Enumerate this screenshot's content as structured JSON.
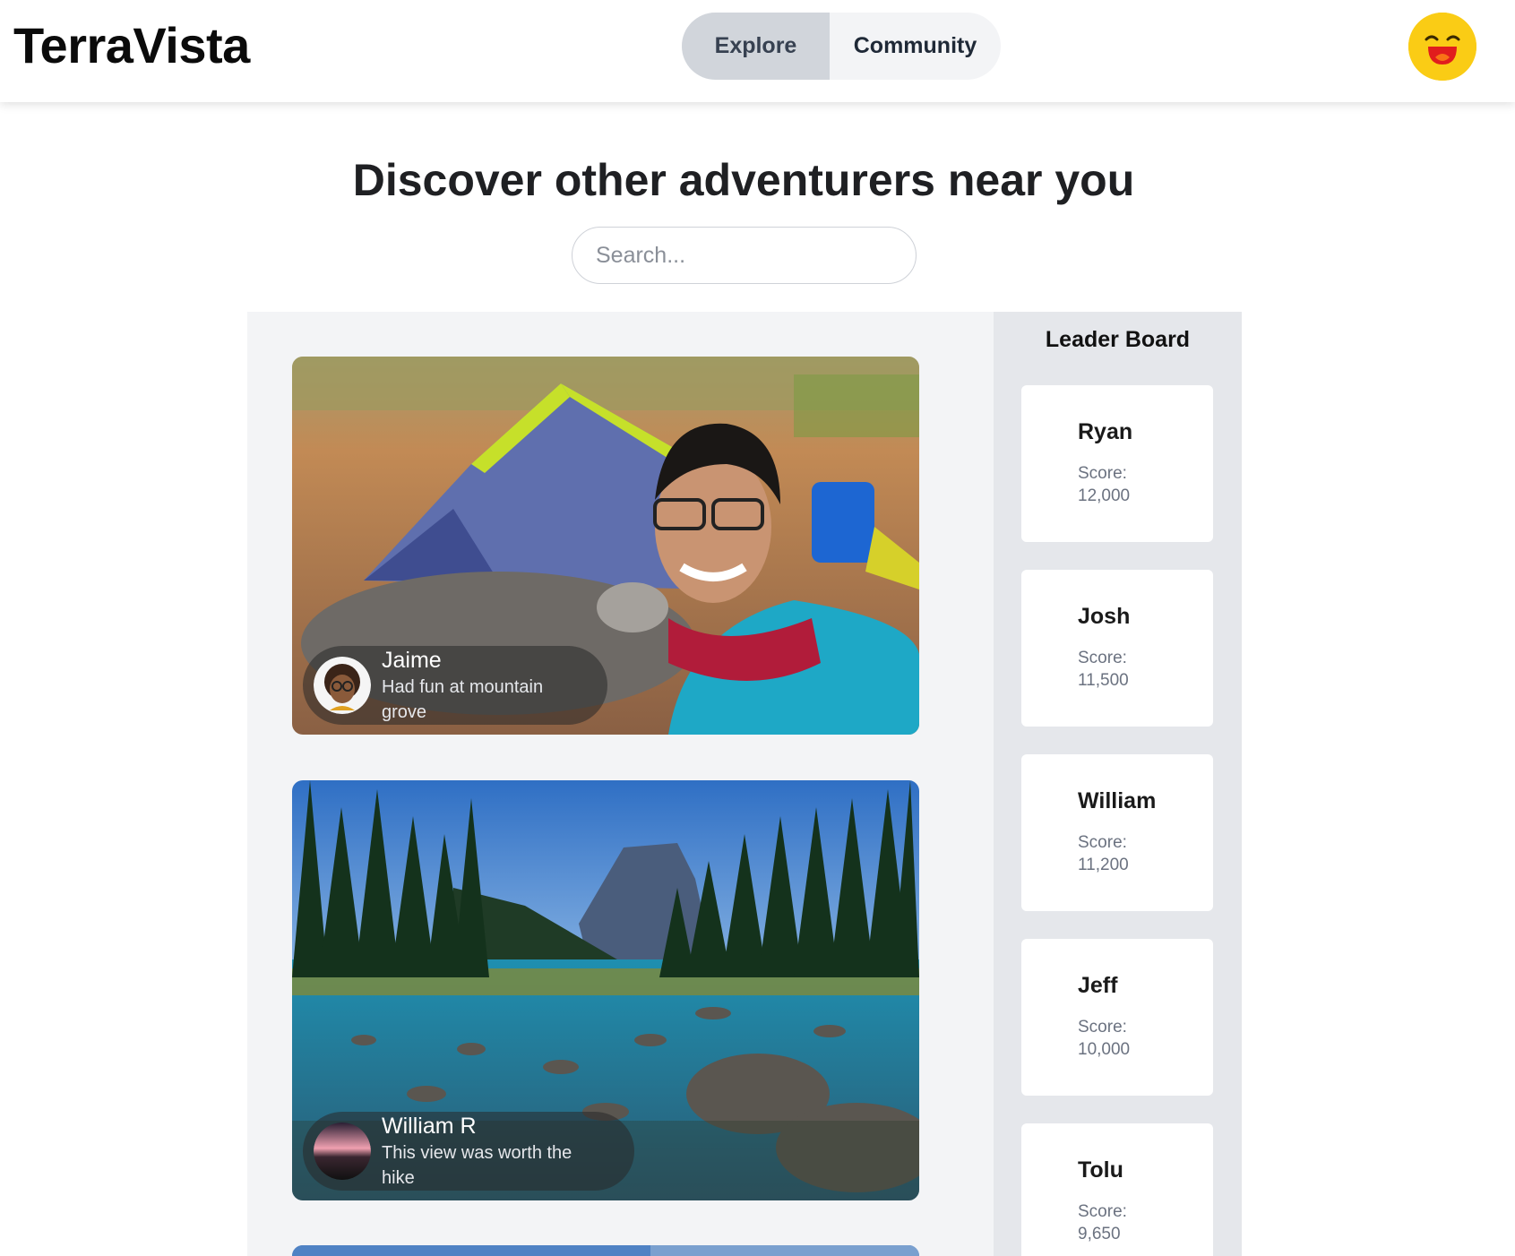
{
  "app": {
    "title": "TerraVista"
  },
  "nav": {
    "tabs": [
      {
        "label": "Explore",
        "active": true
      },
      {
        "label": "Community",
        "active": false
      }
    ]
  },
  "user": {
    "avatar_icon": "laughing-face-icon",
    "avatar_color": "#facc15"
  },
  "main": {
    "title": "Discover other adventurers near you",
    "search": {
      "placeholder": "Search...",
      "value": ""
    }
  },
  "feed": {
    "posts": [
      {
        "name": "Jaime",
        "caption": "Had fun at mountain grove",
        "image": "camping-selfie-photo"
      },
      {
        "name": "William R",
        "caption": "This view was worth the hike",
        "image": "mountain-lake-photo"
      },
      {
        "name": "",
        "caption": "",
        "image": "sky-photo"
      }
    ]
  },
  "leaderboard": {
    "title": "Leader Board",
    "score_label": "Score:",
    "entries": [
      {
        "name": "Ryan",
        "score": "12,000"
      },
      {
        "name": "Josh",
        "score": "11,500"
      },
      {
        "name": "William",
        "score": "11,200"
      },
      {
        "name": "Jeff",
        "score": "10,000"
      },
      {
        "name": "Tolu",
        "score": "9,650"
      }
    ]
  },
  "colors": {
    "accent": "#facc15",
    "tab_active": "#d1d5db",
    "panel": "#f3f4f6",
    "leader_panel": "#e5e7eb"
  }
}
